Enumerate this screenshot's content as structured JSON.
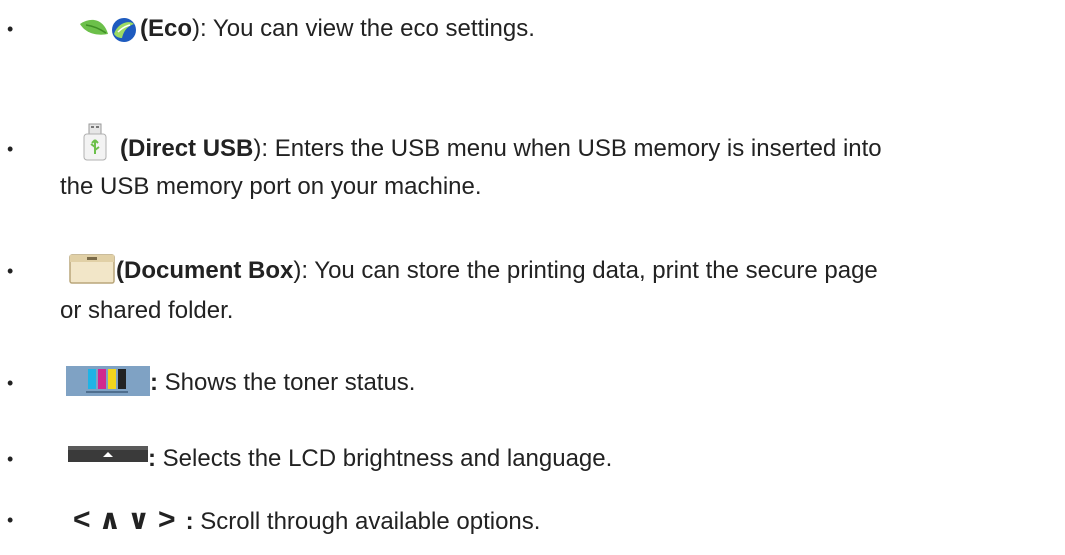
{
  "items": [
    {
      "icon": "eco-leaf-icon",
      "open": "(",
      "name": "Eco",
      "close": "):",
      "desc": " You can view the eco settings.",
      "desc2": ""
    },
    {
      "icon": "usb-drive-icon",
      "open": "(",
      "name": "Direct USB",
      "close": "):",
      "desc": " Enters the USB menu when USB memory is inserted into",
      "desc2": "the USB memory port on your machine."
    },
    {
      "icon": "document-box-icon",
      "open": "(",
      "name": "Document Box",
      "close": "):",
      "desc": " You can store the printing data, print the secure page",
      "desc2": "or shared folder."
    },
    {
      "icon": "toner-status-icon",
      "colon": ":",
      "desc": " Shows the toner status."
    },
    {
      "icon": "brightness-tab-icon",
      "colon": ":",
      "desc": " Selects the LCD brightness  and language."
    },
    {
      "icons": [
        "left-arrow-icon",
        "up-arrow-icon",
        "down-arrow-icon",
        "right-arrow-icon"
      ],
      "glyphs": [
        "<",
        "∧",
        "∨",
        ">"
      ],
      "colon": ":",
      "desc": " Scroll through available options."
    }
  ],
  "colors": {
    "text": "#222222",
    "eco_blue": "#1e5bbf",
    "eco_green": "#6cc04a"
  }
}
